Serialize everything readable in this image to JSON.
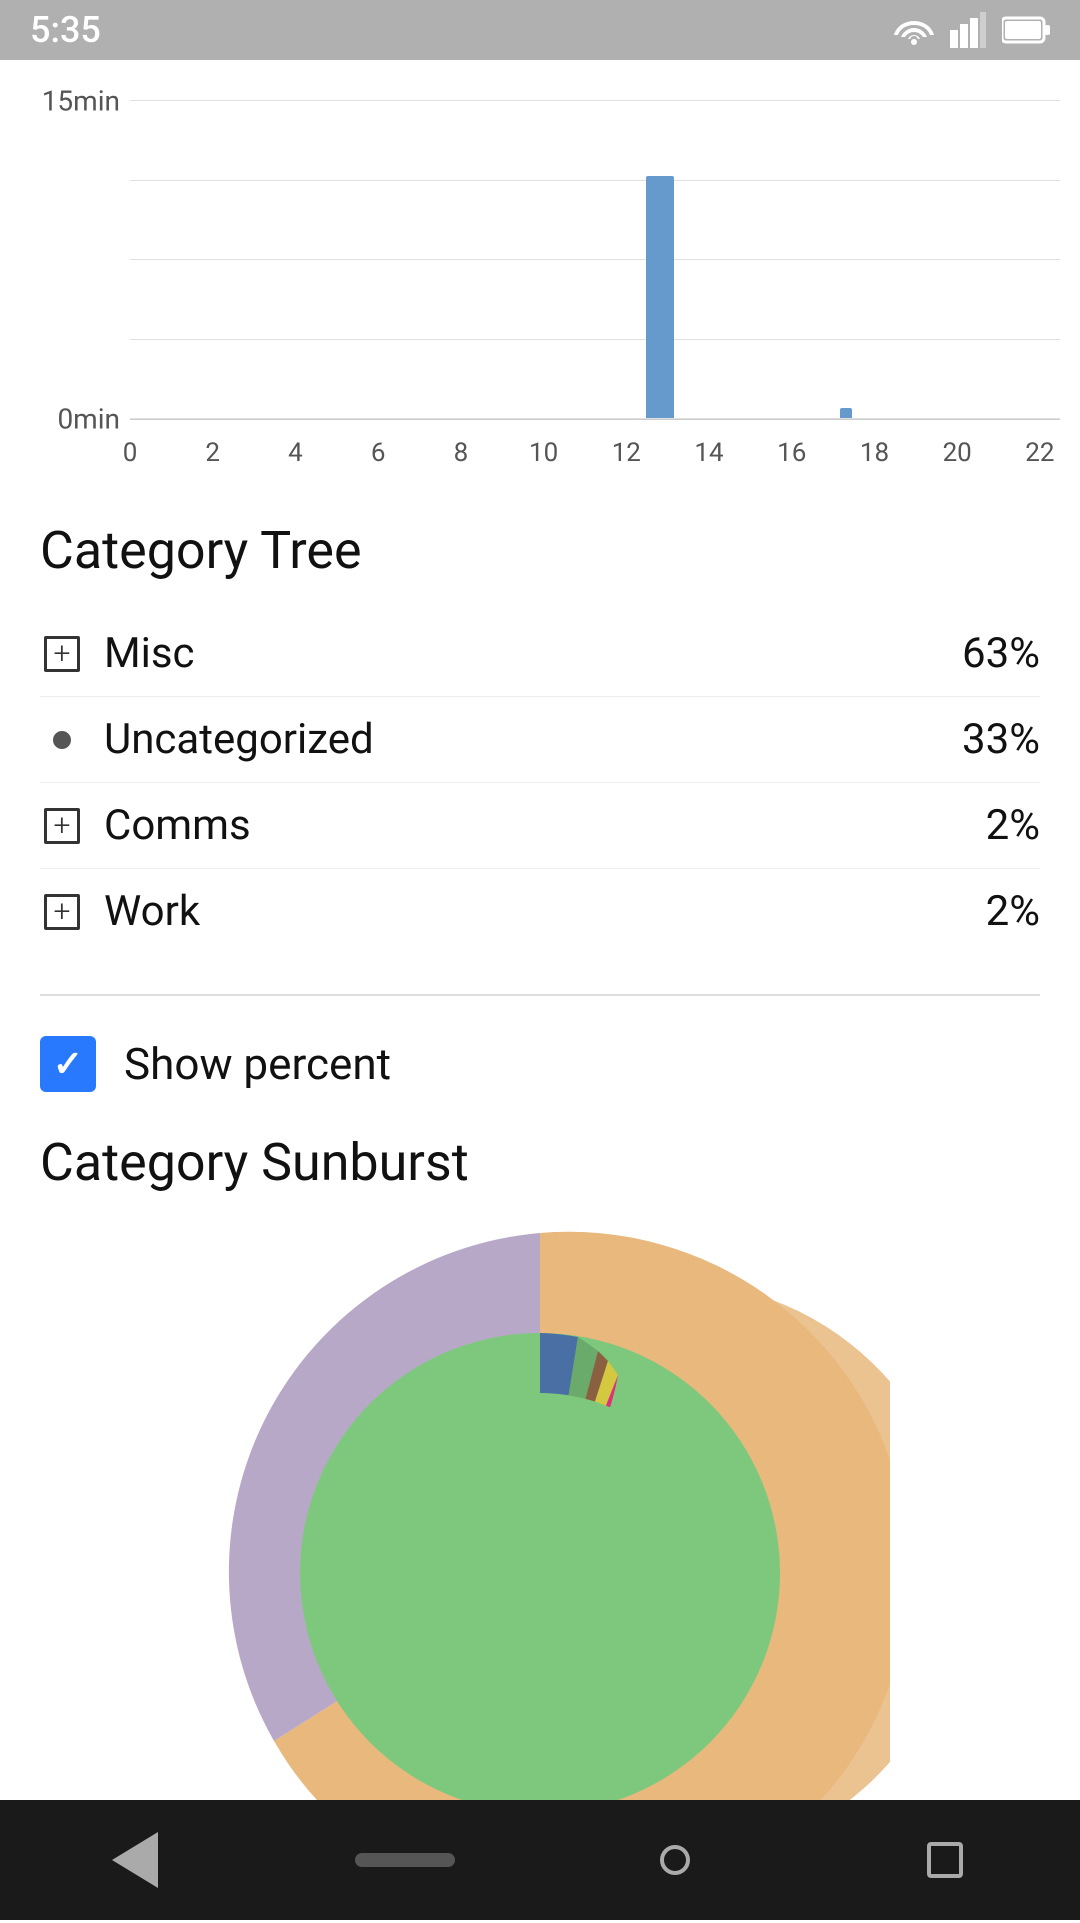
{
  "statusBar": {
    "time": "5:35"
  },
  "barChart": {
    "yLabels": [
      "15min",
      "0min"
    ],
    "xLabels": [
      "0",
      "2",
      "4",
      "6",
      "8",
      "10",
      "12",
      "14",
      "16",
      "18",
      "20",
      "22"
    ],
    "bars": [
      {
        "x": 13,
        "height": 75,
        "label": "13"
      },
      {
        "x": 17,
        "height": 3,
        "label": "17"
      }
    ]
  },
  "categoryTree": {
    "title": "Category Tree",
    "items": [
      {
        "icon": "plus",
        "label": "Misc",
        "value": "63%"
      },
      {
        "icon": "dot",
        "label": "Uncategorized",
        "value": "33%"
      },
      {
        "icon": "plus",
        "label": "Comms",
        "value": "2%"
      },
      {
        "icon": "plus",
        "label": "Work",
        "value": "2%"
      }
    ]
  },
  "showPercent": {
    "label": "Show percent",
    "checked": true
  },
  "sunburst": {
    "title": "Category Sunburst"
  }
}
